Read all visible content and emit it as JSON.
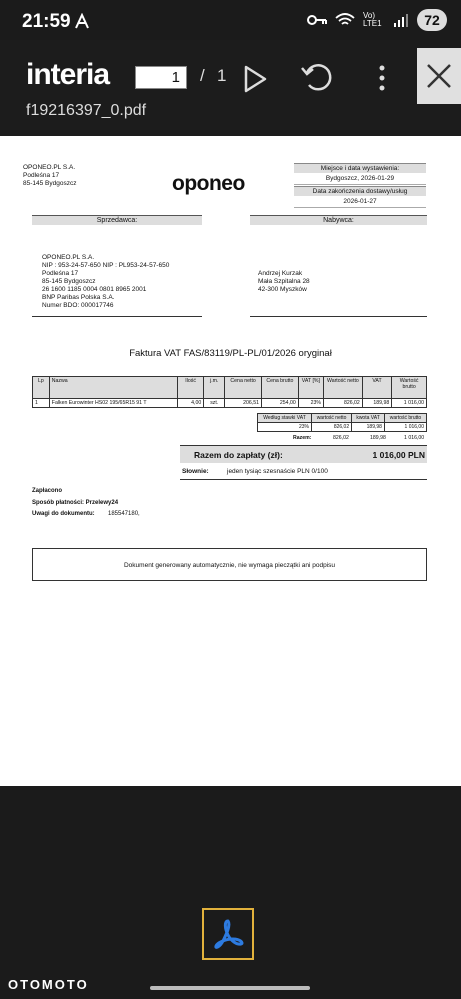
{
  "status": {
    "time": "21:59",
    "network": "Vo) LTE1",
    "battery": "72"
  },
  "toolbar": {
    "logo": "interia",
    "page_current": "1",
    "page_separator": "/",
    "page_total": "1",
    "filename": "f19216397_0.pdf"
  },
  "invoice": {
    "seller_top": [
      "OPONEO.PL S.A.",
      "Podleśna 17",
      "85-145 Bydgoszcz"
    ],
    "brand": "oponeo",
    "meta": [
      {
        "label": "Miejsce i data wystawienia:",
        "value": "Bydgoszcz, 2026-01-29"
      },
      {
        "label": "Data zakończenia dostawy/usług",
        "value": "2026-01-27"
      }
    ],
    "seller_label": "Sprzedawca:",
    "buyer_label": "Nabywca:",
    "seller": [
      "OPONEO.PL S.A.",
      "NIP : 953-24-57-650  NIP : PL953-24-57-650",
      "Podleśna 17",
      "85-145 Bydgoszcz",
      "26 1600 1185 0004 0801 8965 2001",
      "BNP Paribas Polska S.A.",
      "Numer BDO: 000017746"
    ],
    "buyer": [
      "Andrzej Kurzak",
      "Mała Szpitalna 28",
      "42-300 Myszków"
    ],
    "title": "Faktura VAT FAS/83119/PL-PL/01/2026 oryginał",
    "columns": [
      "Lp",
      "Nazwa",
      "Ilość",
      "j.m.",
      "Cena netto",
      "Cena brutto",
      "VAT [%]",
      "Wartość netto",
      "VAT",
      "Wartość brutto"
    ],
    "rows": [
      [
        "1",
        "Falken Eurowinter HS02 195/65R15 91 T",
        "4,00",
        "szt.",
        "206,51",
        "254,00",
        "23%",
        "826,02",
        "189,98",
        "1 016,00"
      ]
    ],
    "vat_columns": [
      "Według stawki VAT",
      "wartość netto",
      "kwota VAT",
      "wartość brutto"
    ],
    "vat_rows": [
      [
        "23%",
        "826,02",
        "189,98",
        "1 016,00"
      ]
    ],
    "sum_label": "Razem:",
    "sum_values": [
      "826,02",
      "189,98",
      "1 016,00"
    ],
    "total_label": "Razem do zapłaty (zł):",
    "total_value": "1 016,00 PLN",
    "words_label": "Słownie:",
    "words_value": "jeden tysiąc szesnaście PLN 0/100",
    "paid": "Zapłacono",
    "payment_label": "Sposób płatności: Przelewy24",
    "notes_label": "Uwagi do dokumentu:",
    "notes_value": "185547180,",
    "notice": "Dokument generowany automatycznie, nie wymaga pieczątki ani podpisu"
  },
  "footer": {
    "watermark": "OTOMOTO"
  },
  "colors": {
    "toolbar_bg": "#1c1c1c",
    "accent_border": "#e2b23c",
    "acrobat_blue": "#2d7be0"
  }
}
